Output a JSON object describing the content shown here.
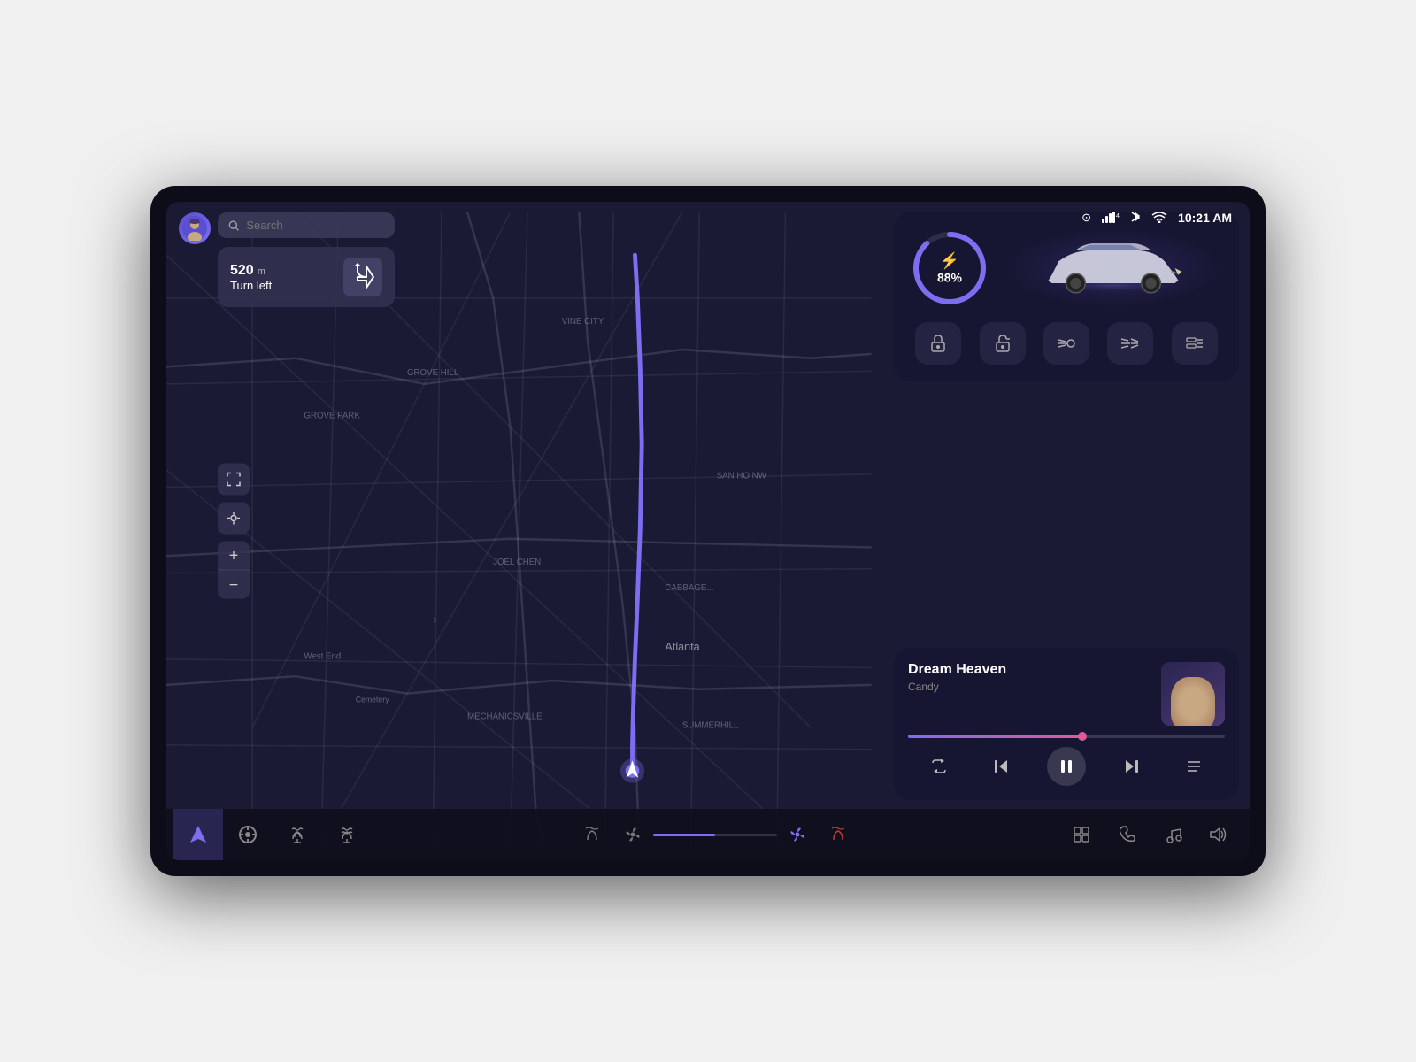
{
  "device": {
    "border_radius": "28px"
  },
  "status_bar": {
    "time": "10:21 AM",
    "icons": [
      "camera",
      "signal",
      "bluetooth",
      "wifi"
    ]
  },
  "search": {
    "placeholder": "Search"
  },
  "navigation": {
    "distance": "520",
    "unit": "m",
    "instruction": "Turn left"
  },
  "battery": {
    "percent": "88%",
    "level": 88
  },
  "music": {
    "title": "Dream Heaven",
    "subtitle": "Candy",
    "progress_percent": 55
  },
  "bottom_bar": {
    "nav_items": [
      "navigate",
      "steering",
      "heat-seat-front",
      "heat-seat-rear"
    ],
    "climate_items": [
      "heat-left",
      "fan",
      "fan-right",
      "heat-right"
    ],
    "right_items": [
      "grid",
      "phone",
      "music",
      "volume"
    ]
  },
  "car_controls": [
    "lock",
    "unlock",
    "headlights",
    "highbeam",
    "lights-menu"
  ]
}
